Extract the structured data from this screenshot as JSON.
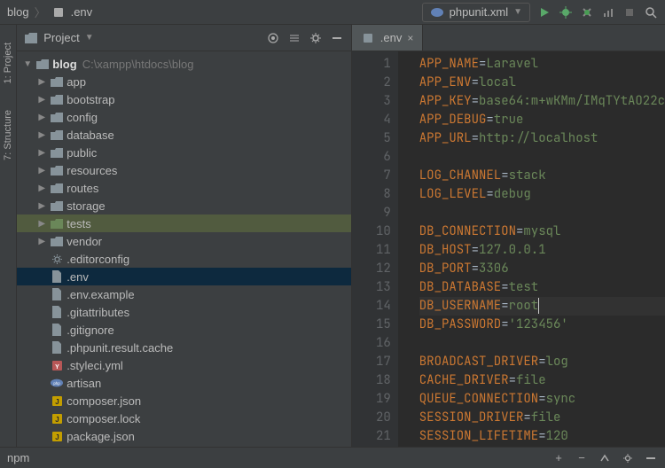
{
  "breadcrumb": {
    "root": "blog",
    "file": ".env"
  },
  "run_config": {
    "label": "phpunit.xml"
  },
  "panel": {
    "title": "Project"
  },
  "side_tabs": {
    "project": "1: Project",
    "structure": "7: Structure"
  },
  "npm_label": "npm",
  "tree": {
    "root": {
      "name": "blog",
      "path": "C:\\xampp\\htdocs\\blog"
    },
    "folders": [
      "app",
      "bootstrap",
      "config",
      "database",
      "public",
      "resources",
      "routes",
      "storage",
      "tests",
      "vendor"
    ],
    "files": [
      ".editorconfig",
      ".env",
      ".env.example",
      ".gitattributes",
      ".gitignore",
      ".phpunit.result.cache",
      ".styleci.yml",
      "artisan",
      "composer.json",
      "composer.lock",
      "package.json"
    ]
  },
  "editor": {
    "tab": ".env",
    "lines": [
      {
        "n": 1,
        "k": "APP_NAME",
        "v": "Laravel"
      },
      {
        "n": 2,
        "k": "APP_ENV",
        "v": "local"
      },
      {
        "n": 3,
        "k": "APP_KEY",
        "v": "base64:m+wKMm/IMqTYtAO22c"
      },
      {
        "n": 4,
        "k": "APP_DEBUG",
        "v": "true"
      },
      {
        "n": 5,
        "k": "APP_URL",
        "v": "http://localhost"
      },
      {
        "n": 6,
        "k": "",
        "v": ""
      },
      {
        "n": 7,
        "k": "LOG_CHANNEL",
        "v": "stack"
      },
      {
        "n": 8,
        "k": "LOG_LEVEL",
        "v": "debug"
      },
      {
        "n": 9,
        "k": "",
        "v": ""
      },
      {
        "n": 10,
        "k": "DB_CONNECTION",
        "v": "mysql"
      },
      {
        "n": 11,
        "k": "DB_HOST",
        "v": "127.0.0.1"
      },
      {
        "n": 12,
        "k": "DB_PORT",
        "v": "3306"
      },
      {
        "n": 13,
        "k": "DB_DATABASE",
        "v": "test"
      },
      {
        "n": 14,
        "k": "DB_USERNAME",
        "v": "root"
      },
      {
        "n": 15,
        "k": "DB_PASSWORD",
        "v": "'123456'"
      },
      {
        "n": 16,
        "k": "",
        "v": ""
      },
      {
        "n": 17,
        "k": "BROADCAST_DRIVER",
        "v": "log"
      },
      {
        "n": 18,
        "k": "CACHE_DRIVER",
        "v": "file"
      },
      {
        "n": 19,
        "k": "QUEUE_CONNECTION",
        "v": "sync"
      },
      {
        "n": 20,
        "k": "SESSION_DRIVER",
        "v": "file"
      },
      {
        "n": 21,
        "k": "SESSION_LIFETIME",
        "v": "120"
      }
    ]
  }
}
